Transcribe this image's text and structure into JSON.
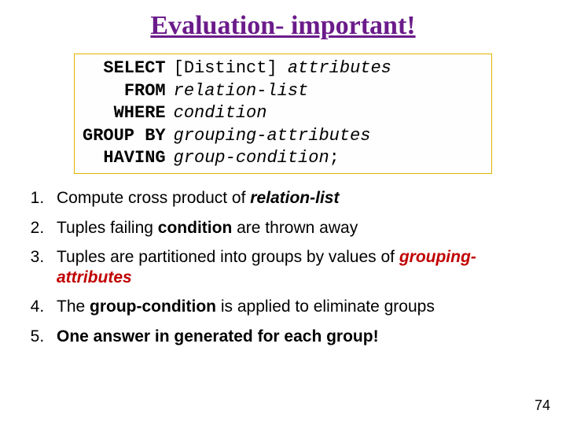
{
  "title": "Evaluation- important!",
  "sql": {
    "kw_select": "SELECT",
    "select_distinct": "[Distinct]",
    "select_arg": " attributes",
    "kw_from": "FROM",
    "from_arg": "relation-list",
    "kw_where": "WHERE",
    "where_arg": "condition",
    "kw_groupby": "GROUP BY",
    "groupby_arg": "grouping-attributes",
    "kw_having": "HAVING",
    "having_arg": "group-condition",
    "terminator": ";"
  },
  "steps": {
    "s1_a": "Compute cross product of ",
    "s1_b": "relation-list",
    "s2_a": "Tuples failing ",
    "s2_b": "condition",
    "s2_c": " are thrown away",
    "s3_a": "Tuples are partitioned into groups by values of ",
    "s3_b": "grouping-attributes",
    "s4_a": "The ",
    "s4_b": "group-condition",
    "s4_c": " is applied to eliminate groups",
    "s5_a": "One answer in generated for each group!"
  },
  "page_number": "74"
}
